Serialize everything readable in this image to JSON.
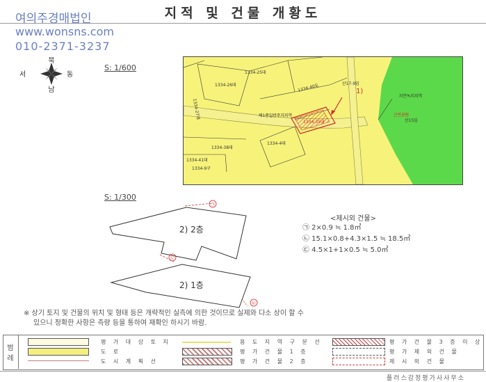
{
  "document": {
    "title": "지적 및 건물 개황도"
  },
  "watermark": {
    "company": "여의주경매법인",
    "website": "www.wonsns.com",
    "phone": "010-2371-3237"
  },
  "compass": {
    "north": "북",
    "south": "남",
    "east": "동",
    "west": "서"
  },
  "cadastral_map": {
    "scale": "S: 1/600",
    "parcels": [
      "1334-25대",
      "1334-26대",
      "1334-27대",
      "1334-40도",
      "1334-38대",
      "1334-4대",
      "1334-41대",
      "1334-9구",
      "산17-9임",
      "제1종일반주거지역",
      "1334-35대",
      "자연녹지지역",
      "근린공원",
      "산15임"
    ],
    "marker": "1)"
  },
  "building_plan": {
    "scale": "S: 1/300",
    "floor2_label": "2) 2층",
    "floor1_label": "2) 1층",
    "markers": [
      "㉠",
      "㉡",
      "㉢"
    ]
  },
  "excluded_buildings": {
    "heading": "<제시외 건물>",
    "items": [
      "㉠ 2×0.9 ≒ 1.8㎡",
      "㉡ 15.1×0.8+4.3×1.5 ≒ 18.5㎡",
      "㉢ 4.5×1+1×0.5 ≒ 5.0㎡"
    ]
  },
  "note": {
    "line1": "※ 상기 토지 및 건물의 위치 및 형태 등은 개략적인 실측에 의한 것이므로 실제와 다소 상이 할 수",
    "line2": "있으니 정확한 사항은 측량 등을 통하여 재확인 하시기 바람."
  },
  "legend": {
    "label_1": "범",
    "label_2": "례",
    "items": [
      "평 가 대 상 토 지",
      "도          로",
      "도 시 계 획 선",
      "용 도 지 역 구 분 선",
      "평 가 건 물 1 층",
      "평 가 건 물 2 층",
      "평 가 건 물 3 층 이 상",
      "평 가 제 외 건 물",
      "제 시 외 건 물"
    ],
    "colors": {
      "land": "#fffbe0",
      "road": "#f5ef80",
      "city_plan_line": "#c08080",
      "zone_line": "#e8e070",
      "floor_fill": "#c88080",
      "excluded_line": "#c84040"
    }
  },
  "footer": {
    "office": "플러스감정평가사사무소"
  },
  "colors": {
    "map_yellow": "#f7f37a",
    "map_green": "#5cd94a",
    "map_red": "#d22a2a",
    "watermark_blue": "#6b7fc0"
  }
}
